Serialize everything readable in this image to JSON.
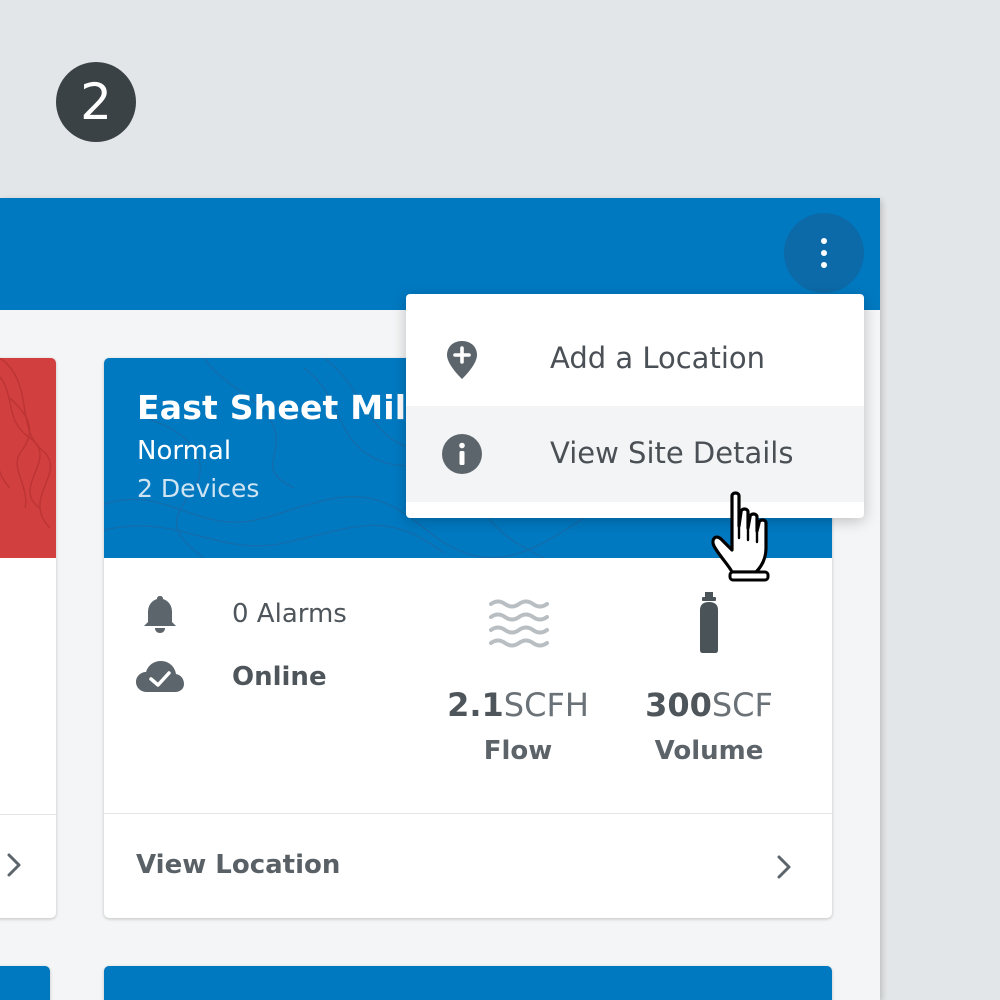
{
  "step": {
    "number": "2"
  },
  "header": {
    "menu_icon": "more-vertical-icon"
  },
  "menu": {
    "items": [
      {
        "label": "Add a Location",
        "icon": "add-location-icon"
      },
      {
        "label": "View Site Details",
        "icon": "info-icon"
      }
    ]
  },
  "site": {
    "title": "East Sheet Mill",
    "status": "Normal",
    "devices": "2 Devices",
    "alarms": "0 Alarms",
    "connection": "Online",
    "flow": {
      "value": "2.1",
      "unit": "SCFH",
      "label": "Flow"
    },
    "volume": {
      "value": "300",
      "unit": "SCF",
      "label": "Volume"
    },
    "footer_label": "View Location"
  },
  "colors": {
    "brand_blue": "#0079c1",
    "alert_red": "#d13f3f",
    "icon_gray": "#5c656b",
    "text_dark": "#4f565b"
  }
}
